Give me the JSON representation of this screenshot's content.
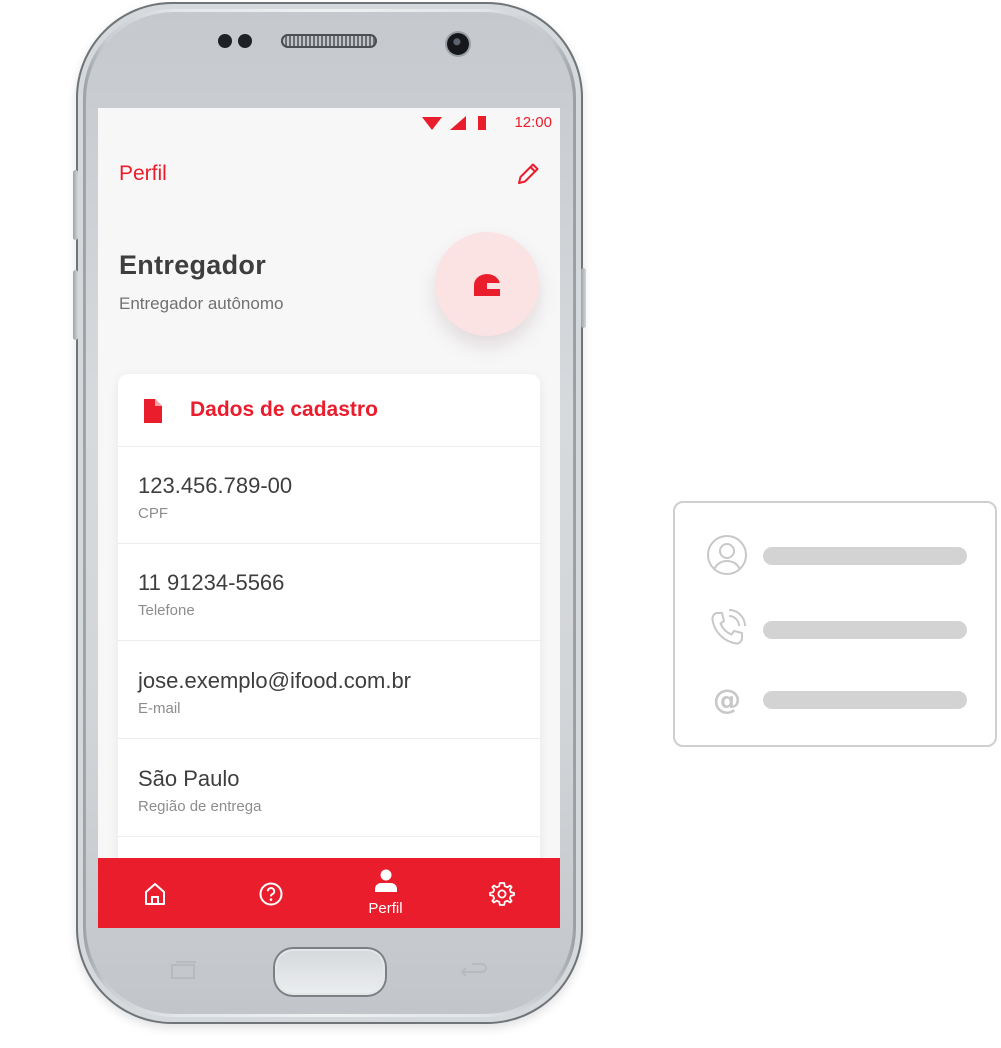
{
  "status_bar": {
    "time": "12:00"
  },
  "header": {
    "title": "Perfil"
  },
  "profile": {
    "name": "Entregador",
    "role": "Entregador autônomo"
  },
  "card": {
    "title": "Dados de cadastro",
    "fields": [
      {
        "value": "123.456.789-00",
        "label": "CPF"
      },
      {
        "value": "11 91234-5566",
        "label": "Telefone"
      },
      {
        "value": "jose.exemplo@ifood.com.br",
        "label": "E-mail"
      },
      {
        "value": "São Paulo",
        "label": "Região de entrega"
      }
    ]
  },
  "bottom_nav": {
    "items": [
      {
        "icon": "home-icon",
        "label": ""
      },
      {
        "icon": "help-icon",
        "label": ""
      },
      {
        "icon": "person-icon",
        "label": "Perfil",
        "active": true
      },
      {
        "icon": "gear-icon",
        "label": ""
      }
    ]
  },
  "contact_card_icons": [
    "user-circle-icon",
    "phone-icon",
    "at-icon"
  ],
  "colors": {
    "brand_red": "#ea1d2c",
    "avatar_bg": "#fbe2e3",
    "text_dark": "#3f3e3e",
    "text_muted": "#8d8d8d",
    "placeholder_bar": "#d3d3d3"
  }
}
